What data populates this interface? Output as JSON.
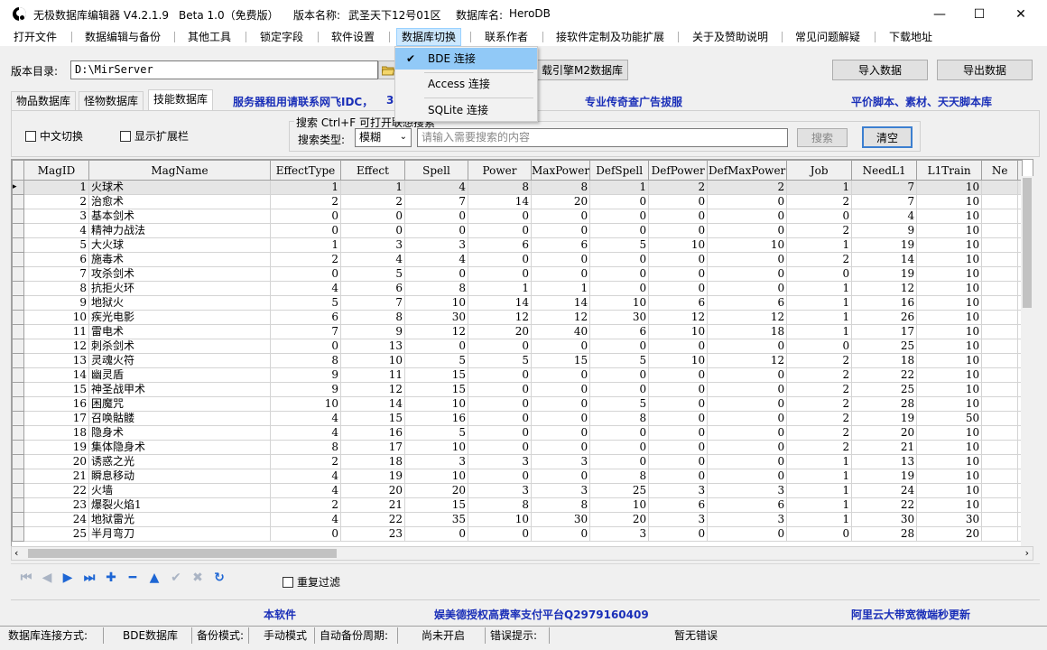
{
  "titlebar": {
    "app_name": "无极数据库编辑器 V4.2.1.9",
    "edition": "Beta 1.0（免费版）",
    "version_label": "版本名称:",
    "version_value": "武圣天下12号01区",
    "db_label": "数据库名:",
    "db_value": "HeroDB",
    "min": "—",
    "max": "☐",
    "close": "✕"
  },
  "menu": [
    {
      "label": "打开文件"
    },
    {
      "label": "数据编辑与备份"
    },
    {
      "label": "其他工具"
    },
    {
      "label": "锁定字段"
    },
    {
      "label": "软件设置"
    },
    {
      "label": "数据库切换"
    },
    {
      "label": "联系作者"
    },
    {
      "label": "接软件定制及功能扩展"
    },
    {
      "label": "关于及赞助说明"
    },
    {
      "label": "常见问题解疑"
    },
    {
      "label": "下载地址"
    }
  ],
  "dropdown": {
    "items": [
      {
        "label": "BDE 连接",
        "checked": true
      },
      {
        "label": "Access 连接"
      },
      {
        "label": "SQLite 连接"
      }
    ],
    "check": "✔"
  },
  "toolbar": {
    "dir_label": "版本目录:",
    "dir_value": "D:\\MirServer",
    "load_btn": "载引擎M2数据库",
    "import_btn": "导入数据",
    "export_btn": "导出数据"
  },
  "tabs": [
    {
      "label": "物品数据库"
    },
    {
      "label": "怪物数据库"
    },
    {
      "label": "技能数据库",
      "active": true
    }
  ],
  "banners": {
    "top1": "服务器租用请联系网飞IDC，",
    "top1_tail": "3",
    "top2": "专业传奇查广告拔服",
    "top3": "平价脚本、素材、天天脚本库",
    "bottom1": "本软件",
    "bottom2": "娱美德授权高费率支付平台Q2979160409",
    "bottom3": "阿里云大带宽微端秒更新"
  },
  "filters": {
    "cn_switch": "中文切换",
    "show_ext": "显示扩展栏",
    "search_group": "搜索   Ctrl+F 可打开联想搜索",
    "search_type_label": "搜索类型:",
    "search_type_value": "模糊",
    "search_placeholder": "请输入需要搜索的内容",
    "search_btn": "搜索",
    "clear_btn": "清空",
    "repeat_filter": "重复过滤"
  },
  "grid": {
    "columns": [
      "MagID",
      "MagName",
      "EffectType",
      "Effect",
      "Spell",
      "Power",
      "MaxPower",
      "DefSpell",
      "DefPower",
      "DefMaxPower",
      "Job",
      "NeedL1",
      "L1Train",
      "Ne"
    ],
    "rows": [
      [
        "1",
        "火球术",
        "1",
        "1",
        "4",
        "8",
        "8",
        "1",
        "2",
        "2",
        "1",
        "7",
        "10",
        ""
      ],
      [
        "2",
        "治愈术",
        "2",
        "2",
        "7",
        "14",
        "20",
        "0",
        "0",
        "0",
        "2",
        "7",
        "10",
        ""
      ],
      [
        "3",
        "基本剑术",
        "0",
        "0",
        "0",
        "0",
        "0",
        "0",
        "0",
        "0",
        "0",
        "4",
        "10",
        ""
      ],
      [
        "4",
        "精神力战法",
        "0",
        "0",
        "0",
        "0",
        "0",
        "0",
        "0",
        "0",
        "2",
        "9",
        "10",
        ""
      ],
      [
        "5",
        "大火球",
        "1",
        "3",
        "3",
        "6",
        "6",
        "5",
        "10",
        "10",
        "1",
        "19",
        "10",
        ""
      ],
      [
        "6",
        "施毒术",
        "2",
        "4",
        "4",
        "0",
        "0",
        "0",
        "0",
        "0",
        "2",
        "14",
        "10",
        ""
      ],
      [
        "7",
        "攻杀剑术",
        "0",
        "5",
        "0",
        "0",
        "0",
        "0",
        "0",
        "0",
        "0",
        "19",
        "10",
        ""
      ],
      [
        "8",
        "抗拒火环",
        "4",
        "6",
        "8",
        "1",
        "1",
        "0",
        "0",
        "0",
        "1",
        "12",
        "10",
        ""
      ],
      [
        "9",
        "地狱火",
        "5",
        "7",
        "10",
        "14",
        "14",
        "10",
        "6",
        "6",
        "1",
        "16",
        "10",
        ""
      ],
      [
        "10",
        "疾光电影",
        "6",
        "8",
        "30",
        "12",
        "12",
        "30",
        "12",
        "12",
        "1",
        "26",
        "10",
        ""
      ],
      [
        "11",
        "雷电术",
        "7",
        "9",
        "12",
        "20",
        "40",
        "6",
        "10",
        "18",
        "1",
        "17",
        "10",
        ""
      ],
      [
        "12",
        "刺杀剑术",
        "0",
        "13",
        "0",
        "0",
        "0",
        "0",
        "0",
        "0",
        "0",
        "25",
        "10",
        ""
      ],
      [
        "13",
        "灵魂火符",
        "8",
        "10",
        "5",
        "5",
        "15",
        "5",
        "10",
        "12",
        "2",
        "18",
        "10",
        ""
      ],
      [
        "14",
        "幽灵盾",
        "9",
        "11",
        "15",
        "0",
        "0",
        "0",
        "0",
        "0",
        "2",
        "22",
        "10",
        ""
      ],
      [
        "15",
        "神圣战甲术",
        "9",
        "12",
        "15",
        "0",
        "0",
        "0",
        "0",
        "0",
        "2",
        "25",
        "10",
        ""
      ],
      [
        "16",
        "困魔咒",
        "10",
        "14",
        "10",
        "0",
        "0",
        "5",
        "0",
        "0",
        "2",
        "28",
        "10",
        ""
      ],
      [
        "17",
        "召唤骷髅",
        "4",
        "15",
        "16",
        "0",
        "0",
        "8",
        "0",
        "0",
        "2",
        "19",
        "50",
        ""
      ],
      [
        "18",
        "隐身术",
        "4",
        "16",
        "5",
        "0",
        "0",
        "0",
        "0",
        "0",
        "2",
        "20",
        "10",
        ""
      ],
      [
        "19",
        "集体隐身术",
        "8",
        "17",
        "10",
        "0",
        "0",
        "0",
        "0",
        "0",
        "2",
        "21",
        "10",
        ""
      ],
      [
        "20",
        "诱惑之光",
        "2",
        "18",
        "3",
        "3",
        "3",
        "0",
        "0",
        "0",
        "1",
        "13",
        "10",
        ""
      ],
      [
        "21",
        "瞬息移动",
        "4",
        "19",
        "10",
        "0",
        "0",
        "8",
        "0",
        "0",
        "1",
        "19",
        "10",
        ""
      ],
      [
        "22",
        "火墙",
        "4",
        "20",
        "20",
        "3",
        "3",
        "25",
        "3",
        "3",
        "1",
        "24",
        "10",
        ""
      ],
      [
        "23",
        "爆裂火焰1",
        "2",
        "21",
        "15",
        "8",
        "8",
        "10",
        "6",
        "6",
        "1",
        "22",
        "10",
        ""
      ],
      [
        "24",
        "地狱雷光",
        "4",
        "22",
        "35",
        "10",
        "30",
        "20",
        "3",
        "3",
        "1",
        "30",
        "30",
        ""
      ],
      [
        "25",
        "半月弯刀",
        "0",
        "23",
        "0",
        "0",
        "0",
        "3",
        "0",
        "0",
        "0",
        "28",
        "20",
        ""
      ]
    ]
  },
  "navigator": [
    "first",
    "prev",
    "next",
    "last",
    "insert",
    "delete",
    "edit",
    "post",
    "cancel",
    "refresh"
  ],
  "statusbar": {
    "conn_label": "数据库连接方式:",
    "conn_value": "BDE数据库",
    "backup_label": "备份模式:",
    "backup_value": "手动模式",
    "auto_label": "自动备份周期:",
    "auto_value": "尚未开启",
    "err_label": "错误提示:",
    "err_value": "暂无错误"
  },
  "colors": {
    "banner_blue": "#1a2fb8",
    "nav_blue": "#1e66d4",
    "menu_highlight": "#cce8ff"
  }
}
